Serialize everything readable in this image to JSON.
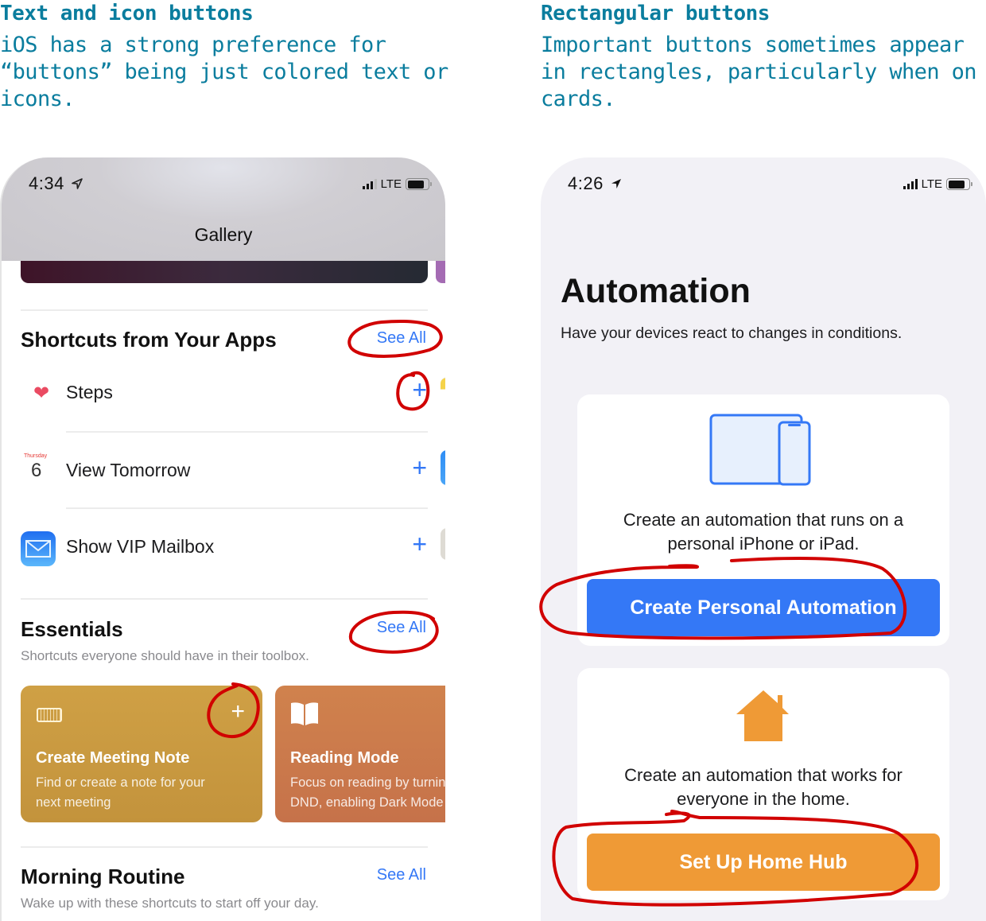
{
  "captions": {
    "left": {
      "title": "Text and icon buttons",
      "body": "iOS has a strong preference for “buttons” being just colored text or icons."
    },
    "right": {
      "title": "Rectangular buttons",
      "body": "Important buttons sometimes appear in rectangles, particularly when on cards."
    }
  },
  "left_phone": {
    "status": {
      "time": "4:34",
      "network": "LTE",
      "location_icon": "location-arrow-outline-icon"
    },
    "nav_title": "Gallery",
    "sections": [
      {
        "title": "Shortcuts from Your Apps",
        "see_all": "See All",
        "items": [
          {
            "label": "Steps",
            "icon": "heart-icon",
            "action": "+"
          },
          {
            "label": "View Tomorrow",
            "icon": "calendar-icon",
            "calendar_day": "Thursday",
            "calendar_date": "6",
            "action": "+"
          },
          {
            "label": "Show VIP Mailbox",
            "icon": "mail-icon",
            "action": "+"
          }
        ]
      },
      {
        "title": "Essentials",
        "see_all": "See All",
        "subtitle": "Shortcuts everyone should have in their toolbox.",
        "cards": [
          {
            "title": "Create Meeting Note",
            "description_line1": "Find or create a note for your",
            "description_line2": "next meeting",
            "icon": "keyboard-icon",
            "action": "+",
            "color": "#c99a40"
          },
          {
            "title": "Reading Mode",
            "description_line1": "Focus on reading by turning on",
            "description_line2": "DND, enabling Dark Mode",
            "icon": "book-icon",
            "color": "#cc7a4b"
          }
        ]
      },
      {
        "title": "Morning Routine",
        "see_all": "See All",
        "subtitle": "Wake up with these shortcuts to start off your day."
      }
    ]
  },
  "right_phone": {
    "status": {
      "time": "4:26",
      "network": "LTE",
      "location_icon": "location-arrow-filled-icon"
    },
    "title": "Automation",
    "subtitle": "Have your devices react to changes in conditions.",
    "cards": [
      {
        "icon": "devices-icon",
        "description_line1": "Create an automation that runs on a",
        "description_line2": "personal iPhone or iPad.",
        "button": "Create Personal Automation",
        "button_color": "#3478f6"
      },
      {
        "icon": "home-icon",
        "description_line1": "Create an automation that works for",
        "description_line2": "everyone in the home.",
        "button": "Set Up Home Hub",
        "button_color": "#ef9a36"
      }
    ]
  },
  "colors": {
    "caption": "#0a7d9e",
    "ios_blue": "#3478f6",
    "annotation_red": "#d10000"
  }
}
